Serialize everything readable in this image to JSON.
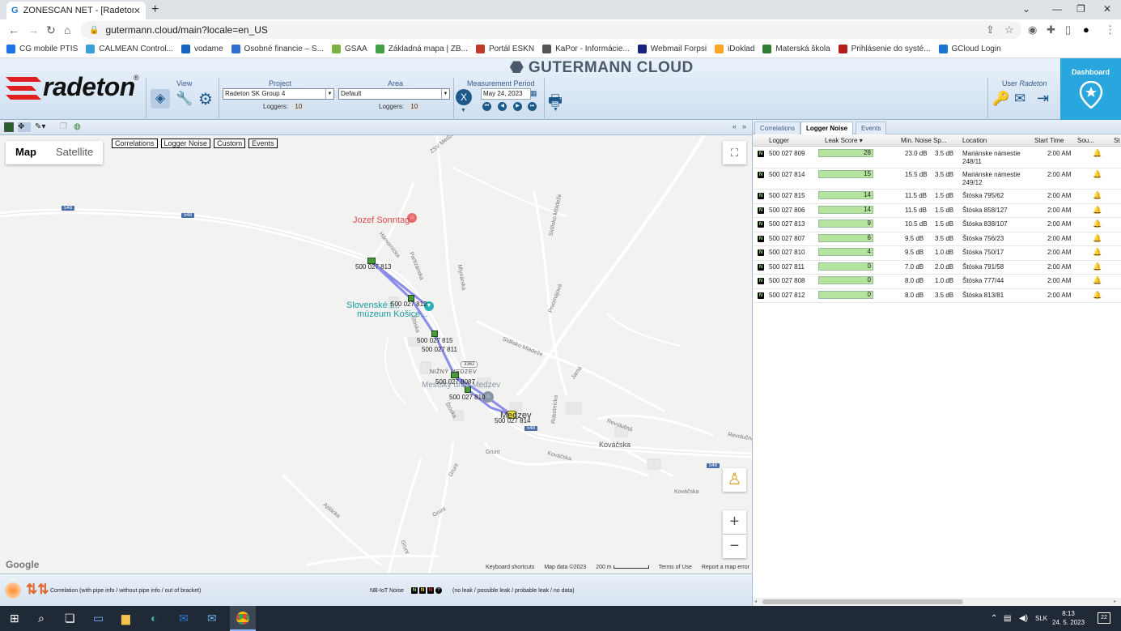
{
  "browser": {
    "tab_title": "ZONESCAN NET - [Radeton SK G",
    "url": "gutermann.cloud/main?locale=en_US",
    "bookmarks": [
      {
        "label": "CG mobile PTIS",
        "color": "#1a73e8"
      },
      {
        "label": "CALMEAN Control...",
        "color": "#3aa0d8"
      },
      {
        "label": "vodame",
        "color": "#1565c0"
      },
      {
        "label": "Osobné financie – S...",
        "color": "#2e6fd0"
      },
      {
        "label": "GSAA",
        "color": "#7cb342"
      },
      {
        "label": "Základná mapa | ZB...",
        "color": "#43a047"
      },
      {
        "label": "Portál ESKN",
        "color": "#c0392b"
      },
      {
        "label": "KaPor - Informácie...",
        "color": "#555555"
      },
      {
        "label": "Webmail Forpsi",
        "color": "#1a237e"
      },
      {
        "label": "iDoklad",
        "color": "#f9a825"
      },
      {
        "label": "Materská škola",
        "color": "#2e7d32"
      },
      {
        "label": "Prihlásenie do systé...",
        "color": "#b71c1c"
      },
      {
        "label": "GCloud Login",
        "color": "#1976d2"
      }
    ]
  },
  "header": {
    "logo_text": "radeton",
    "logo_reg": "®",
    "app_title": "GUTERMANN CLOUD",
    "view_label": "View",
    "project_label": "Project",
    "project_value": "Radeton SK Group 4",
    "project_loggers_label": "Loggers:",
    "project_loggers_count": "10",
    "area_label": "Area",
    "area_value": "Default",
    "area_loggers_label": "Loggers:",
    "area_loggers_count": "10",
    "period_label": "Measurement Period",
    "period_value": "May 24, 2023",
    "user_label_prefix": "User",
    "user_name": "Radeton",
    "dashboard_label": "Dashboard"
  },
  "map": {
    "type_map": "Map",
    "type_satellite": "Satellite",
    "layers": [
      "Correlations",
      "Logger Noise",
      "Custom",
      "Events"
    ],
    "poi_sonntag": "Jozef Sonntag",
    "poi_museum_1": "Slovenské t...",
    "poi_museum_2": "múzeum Košice...",
    "place_nizny": "NIŽNÝ MEDZEV",
    "place_mestsky": "Mestský úrad Medzev",
    "place_medzev": "Medzev",
    "roads": [
      "548",
      "548",
      "548",
      "548",
      "3362"
    ],
    "streets": [
      "Hámornícka",
      "Partizánska",
      "Mlynárska",
      "Štóska",
      "Sídlisko Mládeže",
      "Sídlisko Mládeže",
      "Jarná",
      "Prvomájová",
      "Štóska",
      "Robotnícka",
      "Revolučná",
      "Revolučná",
      "Kováčska",
      "Kováčska",
      "Kováčska",
      "Grunt",
      "Grunt",
      "Grunt",
      "Grunt",
      "Ajdácka",
      "ZSV Medzev"
    ],
    "logger_labels": [
      {
        "text": "500 027 813"
      },
      {
        "text": "500 027 812"
      },
      {
        "text": "500 027 815"
      },
      {
        "text": "500 027 811"
      },
      {
        "text": "500 027 8087"
      },
      {
        "text": "500 027 810"
      },
      {
        "text": "500 027 814"
      }
    ],
    "google": "Google",
    "footer": [
      "Keyboard shortcuts",
      "Map data ©2023",
      "200 m",
      "Terms of Use",
      "Report a map error"
    ]
  },
  "legend": {
    "correlation_text": "Correlation (with pipe info / without pipe info / out of bracket)",
    "nbiot_label": "NB-IoT Noise",
    "nbiot_text": "(no leak / possible leak / probable leak / no data)"
  },
  "panel": {
    "tabs": [
      "Correlations",
      "Logger Noise",
      "Events"
    ],
    "active_tab": "Logger Noise",
    "columns": [
      "Logger",
      "Leak Score ▾",
      "Min. Noise",
      "Sp...",
      "Location",
      "Start Time",
      "Sou...",
      "St"
    ],
    "rows": [
      {
        "logger": "500 027 809",
        "score": 28,
        "noise": "23.0 dB",
        "sp": "3.5 dB",
        "location": "Mariánske námestie 248/11",
        "start": "2:00 AM"
      },
      {
        "logger": "500 027 814",
        "score": 15,
        "noise": "15.5 dB",
        "sp": "3.5 dB",
        "location": "Mariánske námestie 249/12",
        "start": "2:00 AM"
      },
      {
        "logger": "500 027 815",
        "score": 14,
        "noise": "11.5 dB",
        "sp": "1.5 dB",
        "location": "Štóska 795/62",
        "start": "2:00 AM"
      },
      {
        "logger": "500 027 806",
        "score": 14,
        "noise": "11.5 dB",
        "sp": "1.5 dB",
        "location": "Štóska 858/127",
        "start": "2:00 AM"
      },
      {
        "logger": "500 027 813",
        "score": 9,
        "noise": "10.5 dB",
        "sp": "1.5 dB",
        "location": "Štóska 838/107",
        "start": "2:00 AM"
      },
      {
        "logger": "500 027 807",
        "score": 6,
        "noise": "9.5 dB",
        "sp": "3.5 dB",
        "location": "Štóska 756/23",
        "start": "2:00 AM"
      },
      {
        "logger": "500 027 810",
        "score": 4,
        "noise": "9.5 dB",
        "sp": "1.0 dB",
        "location": "Štóska 750/17",
        "start": "2:00 AM"
      },
      {
        "logger": "500 027 811",
        "score": 0,
        "noise": "7.0 dB",
        "sp": "2.0 dB",
        "location": "Štóska 791/58",
        "start": "2:00 AM"
      },
      {
        "logger": "500 027 808",
        "score": 0,
        "noise": "8.0 dB",
        "sp": "1.0 dB",
        "location": "Štóska 777/44",
        "start": "2:00 AM"
      },
      {
        "logger": "500 027 812",
        "score": 0,
        "noise": "8.0 dB",
        "sp": "3.5 dB",
        "location": "Štóska 813/81",
        "start": "2:00 AM"
      }
    ]
  },
  "taskbar": {
    "lang": "SLK",
    "time": "8:13",
    "date": "24. 5. 2023",
    "notif": "22"
  }
}
